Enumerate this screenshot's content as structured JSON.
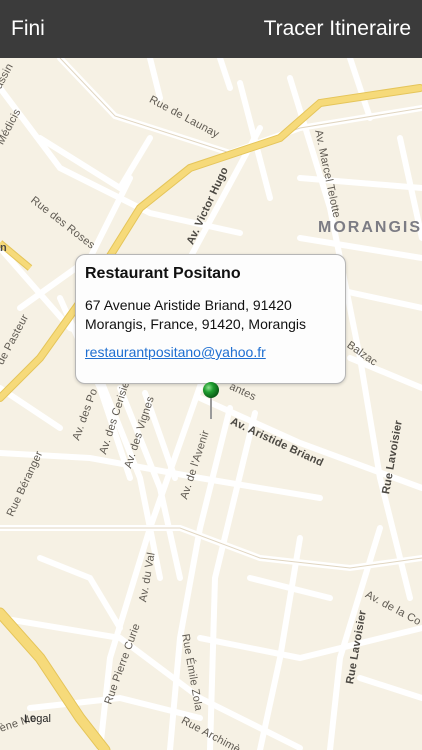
{
  "navbar": {
    "left_label": "Fini",
    "right_label": "Tracer Itineraire"
  },
  "map": {
    "city_label": "MORANGIS",
    "legal_label": "Legal",
    "streets": {
      "launay": "Rue de Launay",
      "medicis": "Médicis",
      "assin": "assin",
      "marcel_telotte": "Av. Marcel Telotte",
      "victor_hugo": "Av. Victor Hugo",
      "roses": "Rue des Roses",
      "pasteur": "de Pasteur",
      "des_po": "Av. des Po",
      "cerisiers": "Av. des Cerisiers",
      "vignes": "Av. des Vignes",
      "beranger": "Rue Béranger",
      "de_l_avenir": "Av. de l'Avenir",
      "aristide_briand": "Av. Aristide Briand",
      "lavoisier_1": "Rue Lavoisier",
      "lavoisier_2": "Rue Lavoisier",
      "de_la_co": "Av. de la Co",
      "du_val": "Av. du Val",
      "pierre_curie": "Rue Pierre Curie",
      "emile_zola": "Rue Émile Zola",
      "archim": "Rue Archimè",
      "balzac": "Balzac",
      "lantes": "antes",
      "ene_mo": "ène Mo",
      "n_edge": "n"
    }
  },
  "callout": {
    "title": "Restaurant Positano",
    "address_line1": "67 Avenue Aristide Briand, 91420",
    "address_line2": "Morangis, France, 91420, Morangis",
    "email": "restaurantpositano@yahoo.fr"
  },
  "colors": {
    "navbar": "#3b3b3b",
    "map_background": "#f6f1e4",
    "major_road": "#f6da7a",
    "pin": "#1f9d2f",
    "link": "#1f6fd1"
  },
  "icons": {
    "pin": "map-pin-icon"
  }
}
